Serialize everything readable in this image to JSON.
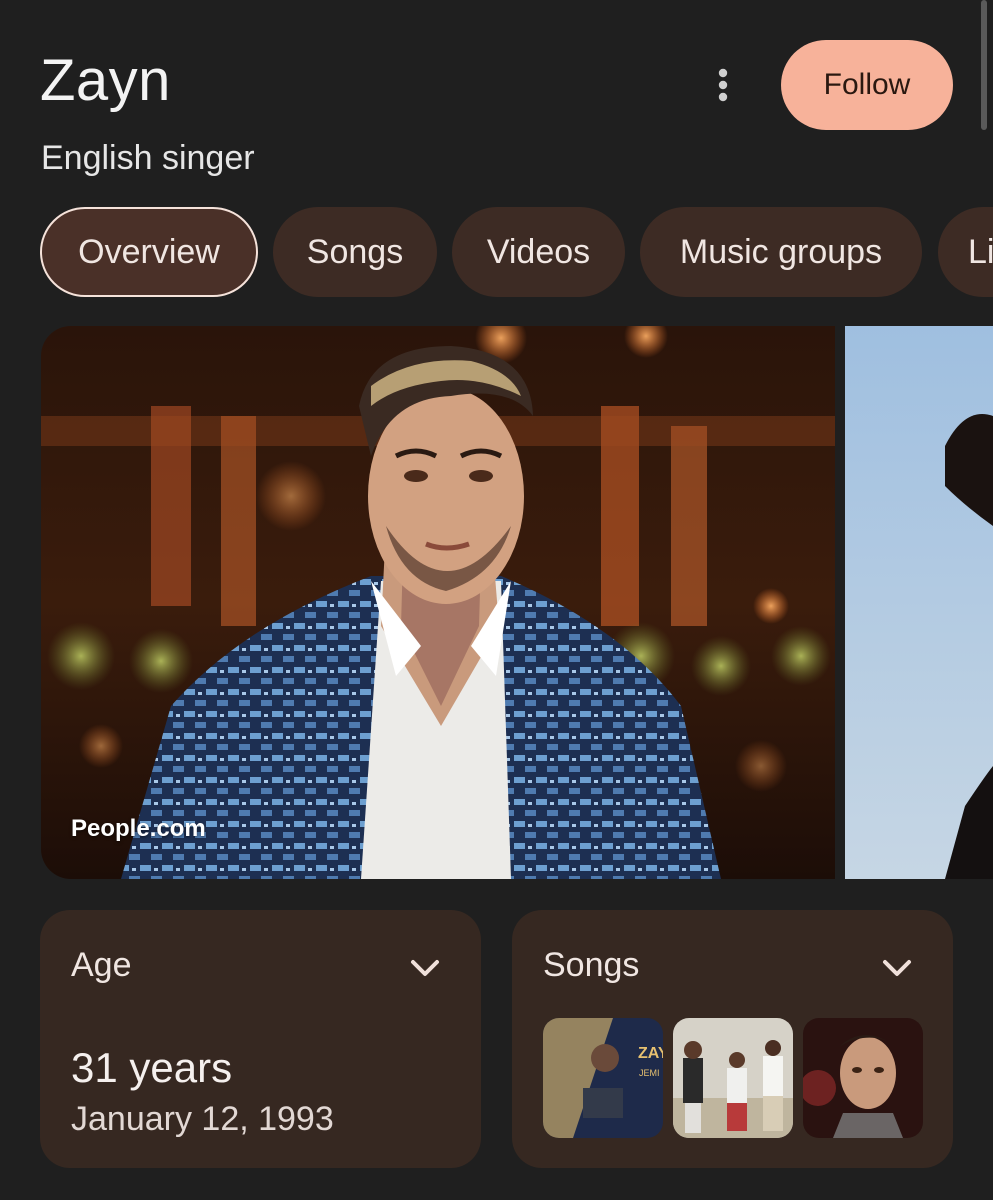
{
  "entity": {
    "title": "Zayn",
    "subtitle": "English singer"
  },
  "header": {
    "more_icon": "more-vert-icon",
    "follow_label": "Follow",
    "follow_color": "#f7b29a"
  },
  "tabs": [
    {
      "label": "Overview",
      "active": true
    },
    {
      "label": "Songs",
      "active": false
    },
    {
      "label": "Videos",
      "active": false
    },
    {
      "label": "Music groups",
      "active": false
    },
    {
      "label": "Li",
      "active": false
    }
  ],
  "images": {
    "main_source": "People.com"
  },
  "cards": {
    "age": {
      "title": "Age",
      "value": "31 years",
      "date": "January 12, 1993",
      "chevron_icon": "chevron-down-icon"
    },
    "songs": {
      "title": "Songs",
      "chevron_icon": "chevron-down-icon",
      "thumb1_text": "ZAY",
      "thumb1_sub": "JEMI"
    }
  },
  "colors": {
    "background": "#1f1f1f",
    "tab_bg": "#3d2b24",
    "card_bg": "#362821"
  }
}
